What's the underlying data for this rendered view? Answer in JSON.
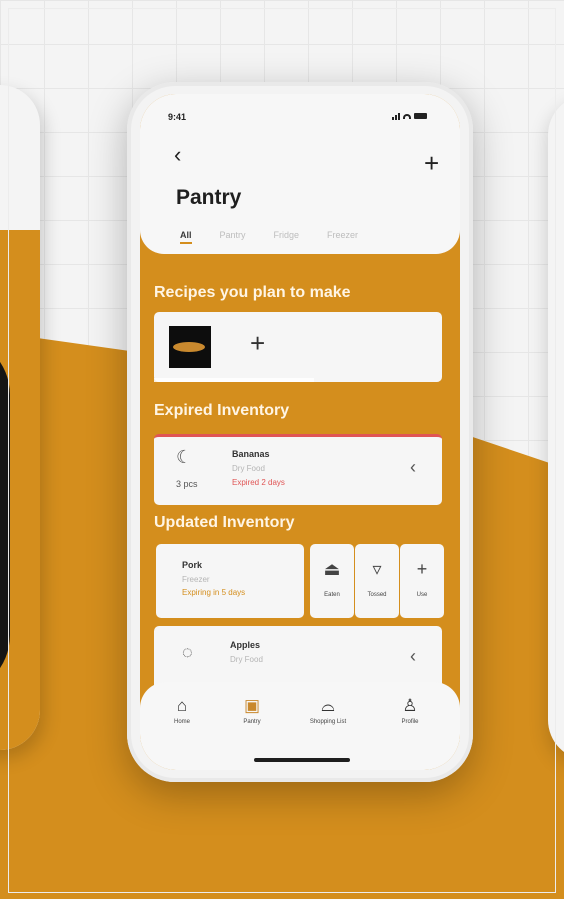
{
  "status_bar": {
    "time": "9:41"
  },
  "header": {
    "back_icon": "chevron-left-icon",
    "add_icon": "plus-icon",
    "title": "Pantry"
  },
  "tabs": [
    {
      "label": "All",
      "active": true
    },
    {
      "label": "Pantry",
      "active": false
    },
    {
      "label": "Fridge",
      "active": false
    },
    {
      "label": "Freezer",
      "active": false
    }
  ],
  "sections": {
    "recipes": "Recipes you plan to make",
    "expired": "Expired Inventory",
    "updated": "Updated Inventory"
  },
  "expired_item": {
    "name": "Bananas",
    "type": "Dry Food",
    "status": "Expired 2 days",
    "qty": "3 pcs"
  },
  "updated_item": {
    "name": "Pork",
    "location": "Freezer",
    "status": "Expiring in 5 days"
  },
  "actions": [
    {
      "label": "Eaten",
      "icon": "cloche-icon"
    },
    {
      "label": "Tossed",
      "icon": "trash-icon"
    },
    {
      "label": "Use",
      "icon": "plus-icon"
    }
  ],
  "apples_item": {
    "name": "Apples",
    "type": "Dry Food"
  },
  "bottom_nav": [
    {
      "label": "Home",
      "icon": "home-icon"
    },
    {
      "label": "Pantry",
      "icon": "pantry-icon"
    },
    {
      "label": "Shopping List",
      "icon": "shopping-bag-icon"
    },
    {
      "label": "Profile",
      "icon": "profile-icon"
    }
  ],
  "colors": {
    "accent": "#d48e1d",
    "expired": "#e05555",
    "surface": "#f6f6f6"
  }
}
